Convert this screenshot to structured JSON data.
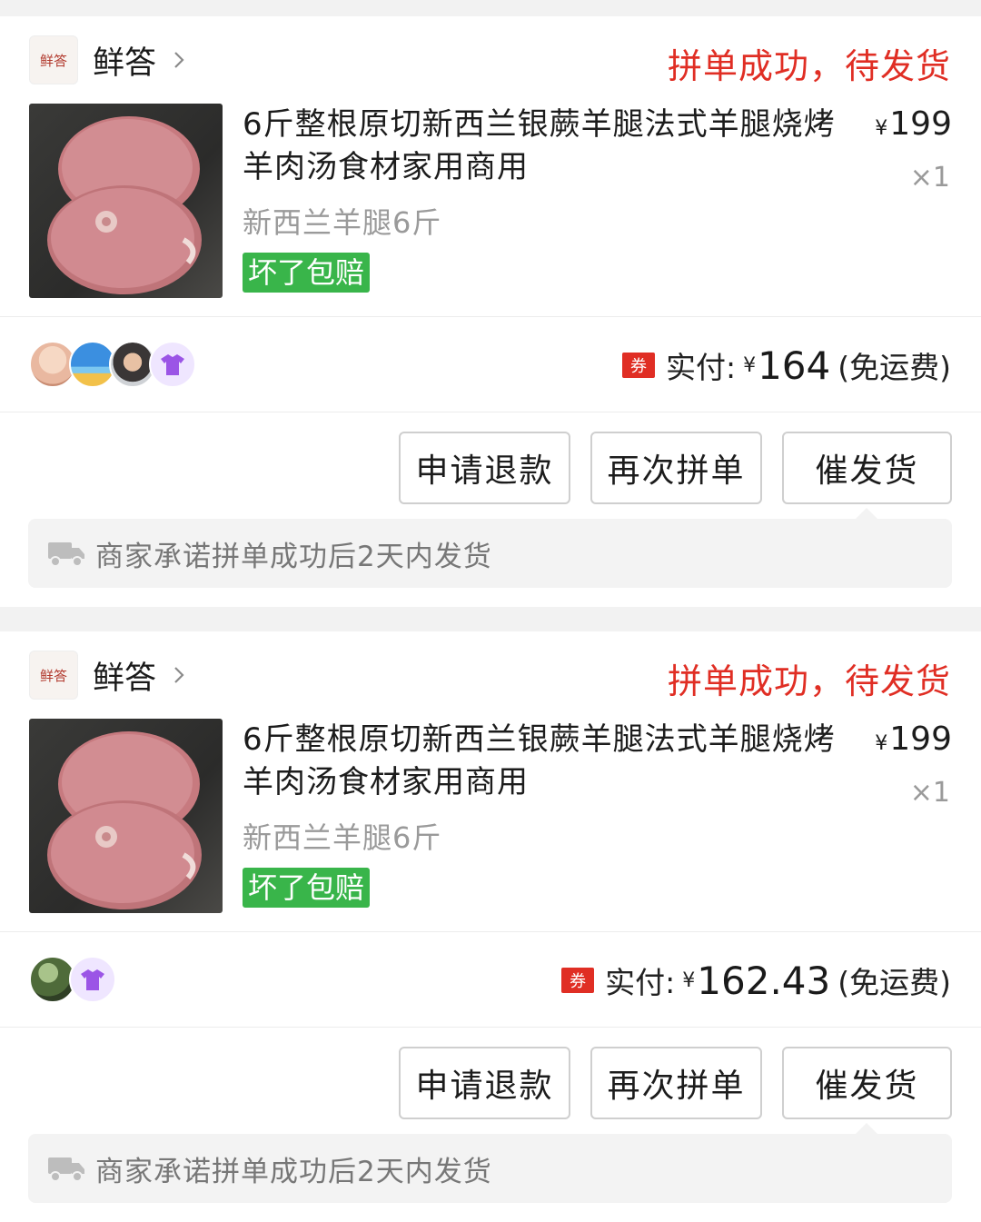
{
  "orders": [
    {
      "shop": {
        "logo_text": "鲜答",
        "name": "鲜答"
      },
      "status": "拼单成功，待发货",
      "product": {
        "title": "6斤整根原切新西兰银蕨羊腿法式羊腿烧烤羊肉汤食材家用商用",
        "spec": "新西兰羊腿6斤",
        "badge": "坏了包赔",
        "price_symbol": "¥",
        "price": "199",
        "qty": "×1"
      },
      "members": [
        "avatar-baby",
        "avatar-beach",
        "avatar-child",
        "avatar-shirt-icon"
      ],
      "payment": {
        "coupon_label": "券",
        "label": "实付:",
        "symbol": "¥",
        "amount": "164",
        "note": "(免运费)"
      },
      "buttons": {
        "refund": "申请退款",
        "regroup": "再次拼单",
        "urge": "催发货"
      },
      "shipping_tip": "商家承诺拼单成功后2天内发货"
    },
    {
      "shop": {
        "logo_text": "鲜答",
        "name": "鲜答"
      },
      "status": "拼单成功，待发货",
      "product": {
        "title": "6斤整根原切新西兰银蕨羊腿法式羊腿烧烤羊肉汤食材家用商用",
        "spec": "新西兰羊腿6斤",
        "badge": "坏了包赔",
        "price_symbol": "¥",
        "price": "199",
        "qty": "×1"
      },
      "members": [
        "avatar-forest",
        "avatar-shirt-icon"
      ],
      "payment": {
        "coupon_label": "券",
        "label": "实付:",
        "symbol": "¥",
        "amount": "162.43",
        "note": "(免运费)"
      },
      "buttons": {
        "refund": "申请退款",
        "regroup": "再次拼单",
        "urge": "催发货"
      },
      "shipping_tip": "商家承诺拼单成功后2天内发货"
    }
  ],
  "colors": {
    "status_red": "#e02e24",
    "badge_green": "#39b54a",
    "page_bg": "#f2f2f2"
  }
}
